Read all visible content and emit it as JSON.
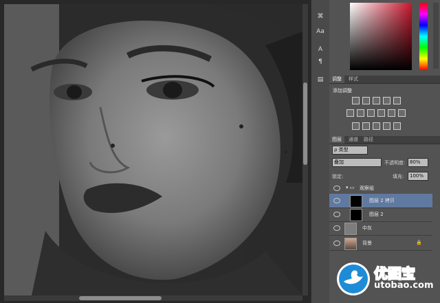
{
  "panels": {
    "adjust_tabs": [
      {
        "label": "调整",
        "active": true
      },
      {
        "label": "样式",
        "active": false
      }
    ],
    "adjust_title": "添加调整",
    "adjust_icons": [
      "brightness-icon",
      "levels-icon",
      "curves-icon",
      "exposure-icon",
      "vibrance-icon",
      "hue-sat-icon",
      "color-balance-icon",
      "bw-icon",
      "photo-filter-icon",
      "channel-mixer-icon",
      "color-lookup-icon",
      "invert-icon",
      "posterize-icon",
      "threshold-icon",
      "selective-color-icon",
      "gradient-map-icon"
    ],
    "layers_tabs": [
      {
        "label": "图层",
        "active": true
      },
      {
        "label": "通道",
        "active": false
      },
      {
        "label": "路径",
        "active": false
      }
    ],
    "kind_filter": "ρ 类型",
    "blend_mode": "叠加",
    "opacity_label": "不透明度:",
    "opacity_value": "80%",
    "lock_label": "锁定:",
    "fill_label": "填充:",
    "fill_value": "100%",
    "layers": [
      {
        "name": "观察组",
        "type": "group"
      },
      {
        "name": "图层 2 拷贝",
        "type": "layer",
        "selected": true
      },
      {
        "name": "图层 2",
        "type": "layer"
      },
      {
        "name": "中灰",
        "type": "layer"
      },
      {
        "name": "背景",
        "type": "background"
      }
    ]
  },
  "toolstrip": [
    "history-icon",
    "character-icon",
    "text-icon",
    "paragraph-icon",
    "layer-comps-icon"
  ],
  "watermark": {
    "brand": "优图宝",
    "url": "utobao.com"
  },
  "colors": {
    "selected_layer": "#6079a0",
    "panel_bg": "#535353",
    "brand_blue": "#1e8bd6"
  }
}
